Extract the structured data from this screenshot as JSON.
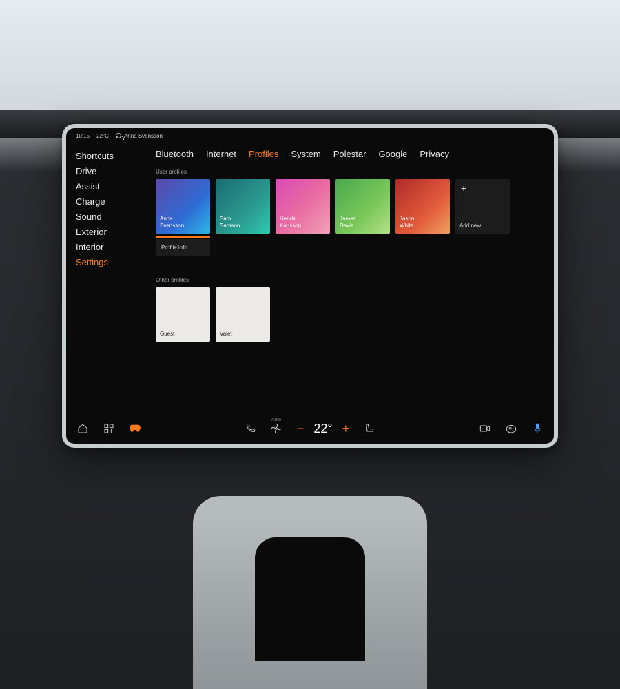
{
  "status": {
    "time": "10:15",
    "temp": "22°C",
    "user": "Anna Svensson"
  },
  "sidebar": {
    "items": [
      {
        "label": "Shortcuts"
      },
      {
        "label": "Drive"
      },
      {
        "label": "Assist"
      },
      {
        "label": "Charge"
      },
      {
        "label": "Sound"
      },
      {
        "label": "Exterior"
      },
      {
        "label": "Interior"
      },
      {
        "label": "Settings",
        "active": true
      }
    ]
  },
  "tabs": [
    {
      "label": "Bluetooth"
    },
    {
      "label": "Internet"
    },
    {
      "label": "Profiles",
      "active": true
    },
    {
      "label": "System"
    },
    {
      "label": "Polestar"
    },
    {
      "label": "Google"
    },
    {
      "label": "Privacy"
    }
  ],
  "sections": {
    "user_label": "User profiles",
    "other_label": "Other profiles",
    "profile_info": "Profile info",
    "add_new": "Add new"
  },
  "profiles": [
    {
      "name": "Anna\nSvensson",
      "gradient": "blue",
      "active": true
    },
    {
      "name": "Sam\nSamson",
      "gradient": "teal"
    },
    {
      "name": "Henrik\nKarlsson",
      "gradient": "pink"
    },
    {
      "name": "James\nDavis",
      "gradient": "green"
    },
    {
      "name": "Jason\nWhite",
      "gradient": "red"
    }
  ],
  "other_profiles": [
    {
      "name": "Guest"
    },
    {
      "name": "Valet"
    }
  ],
  "climate": {
    "mode": "Auto",
    "temp": "22°"
  },
  "colors": {
    "accent": "#ff7a1a"
  }
}
